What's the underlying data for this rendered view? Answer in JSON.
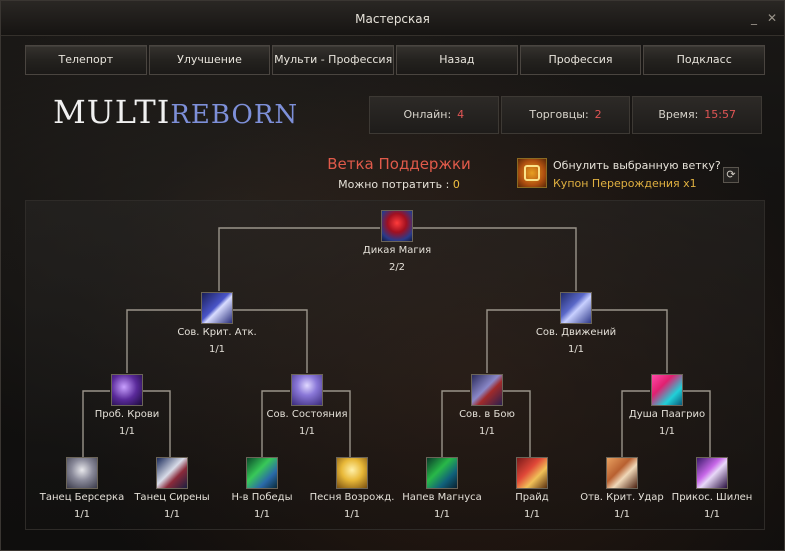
{
  "window": {
    "title": "Мастерская"
  },
  "nav": [
    "Телепорт",
    "Улучшение",
    "Мульти - Профессия",
    "Назад",
    "Профессия",
    "Подкласс"
  ],
  "logo": {
    "part1": "MULTI",
    "part2": "REBORN"
  },
  "stats": [
    {
      "label": "Онлайн:",
      "value": "4"
    },
    {
      "label": "Торговцы:",
      "value": "2"
    },
    {
      "label": "Время:",
      "value": "15:57"
    }
  ],
  "branch": {
    "title": "Ветка Поддержки",
    "spend_label": "Можно потратить :",
    "spend_value": "0"
  },
  "reset": {
    "question": "Обнулить выбранную ветку?",
    "coupon": "Купон Перерождения x1",
    "icon": "coupon-icon"
  },
  "skills": [
    {
      "name": "Дикая Магия",
      "level": "2/2",
      "icon": "wild-magic-icon"
    },
    {
      "name": "Сов. Крит. Атк.",
      "level": "1/1",
      "icon": "crit-attack-icon"
    },
    {
      "name": "Сов. Движений",
      "level": "1/1",
      "icon": "movement-icon"
    },
    {
      "name": "Проб. Крови",
      "level": "1/1",
      "icon": "blood-awakening-icon"
    },
    {
      "name": "Сов. Состояния",
      "level": "1/1",
      "icon": "condition-icon"
    },
    {
      "name": "Сов. в Бою",
      "level": "1/1",
      "icon": "combat-icon"
    },
    {
      "name": "Душа Паагрио",
      "level": "1/1",
      "icon": "paagrio-soul-icon"
    },
    {
      "name": "Танец Берсерка",
      "level": "1/1",
      "icon": "berserker-dance-icon"
    },
    {
      "name": "Танец Сирены",
      "level": "1/1",
      "icon": "siren-dance-icon"
    },
    {
      "name": "Н-в Победы",
      "level": "1/1",
      "icon": "victory-chant-icon"
    },
    {
      "name": "Песня Возрожд.",
      "level": "1/1",
      "icon": "revival-song-icon"
    },
    {
      "name": "Напев Магнуса",
      "level": "1/1",
      "icon": "magnus-chant-icon"
    },
    {
      "name": "Прайд",
      "level": "1/1",
      "icon": "pride-icon"
    },
    {
      "name": "Отв. Крит. Удар",
      "level": "1/1",
      "icon": "counter-crit-icon"
    },
    {
      "name": "Прикос. Шилен",
      "level": "1/1",
      "icon": "shilen-touch-icon"
    }
  ]
}
